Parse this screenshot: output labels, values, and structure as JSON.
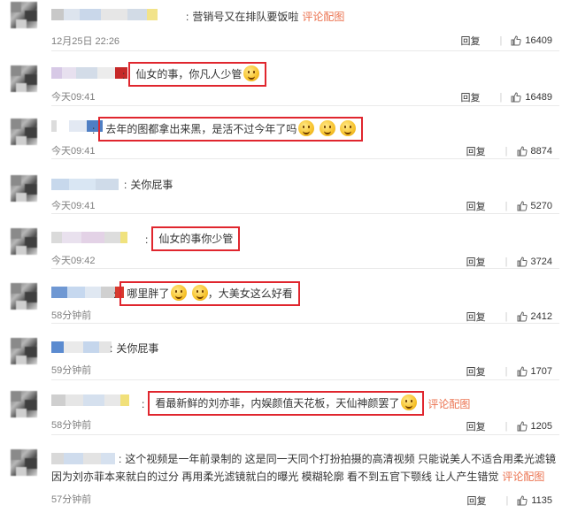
{
  "comments": [
    {
      "text": "营销号又在排队要饭啦",
      "link": "评论配图",
      "time": "12月25日 22:26",
      "reply": "回复",
      "likes": "16409",
      "highlighted": false
    },
    {
      "text": "仙女的事，你凡人少管",
      "link": "",
      "time": "今天09:41",
      "reply": "回复",
      "likes": "16489",
      "highlighted": true
    },
    {
      "text": "去年的图都拿出来黑，是活不过今年了吗",
      "link": "",
      "time": "今天09:41",
      "reply": "回复",
      "likes": "8874",
      "highlighted": true
    },
    {
      "text": "关你屁事",
      "link": "",
      "time": "今天09:41",
      "reply": "回复",
      "likes": "5270",
      "highlighted": false
    },
    {
      "text": "仙女的事你少管",
      "link": "",
      "time": "今天09:42",
      "reply": "回复",
      "likes": "3724",
      "highlighted": true
    },
    {
      "text_before": "哪里胖了",
      "text_after": "，大美女这么好看",
      "link": "",
      "time": "58分钟前",
      "reply": "回复",
      "likes": "2412",
      "highlighted": true
    },
    {
      "text": "关你屁事",
      "link": "",
      "time": "59分钟前",
      "reply": "回复",
      "likes": "1707",
      "highlighted": false
    },
    {
      "text": "看最新鲜的刘亦菲，内娱颜值天花板，天仙神颜罢了",
      "link": "评论配图",
      "time": "58分钟前",
      "reply": "回复",
      "likes": "1205",
      "highlighted": true
    },
    {
      "text": "这个视频是一年前录制的 这是同一天同个打扮拍摄的高清视频 只能说美人不适合用柔光滤镜 因为刘亦菲本来就白的过分 再用柔光滤镜就白的曝光 模糊轮廓 看不到五官下颚线 让人产生错觉",
      "link": "评论配图",
      "time": "57分钟前",
      "reply": "回复",
      "likes": "1135",
      "highlighted": false
    }
  ],
  "colors": {
    "highlight_border": "#e0262e",
    "link": "#eb7350",
    "meta": "#808080"
  },
  "icons": {
    "like": "thumbs-up-icon",
    "emoji": "smiley-emoji-icon"
  }
}
